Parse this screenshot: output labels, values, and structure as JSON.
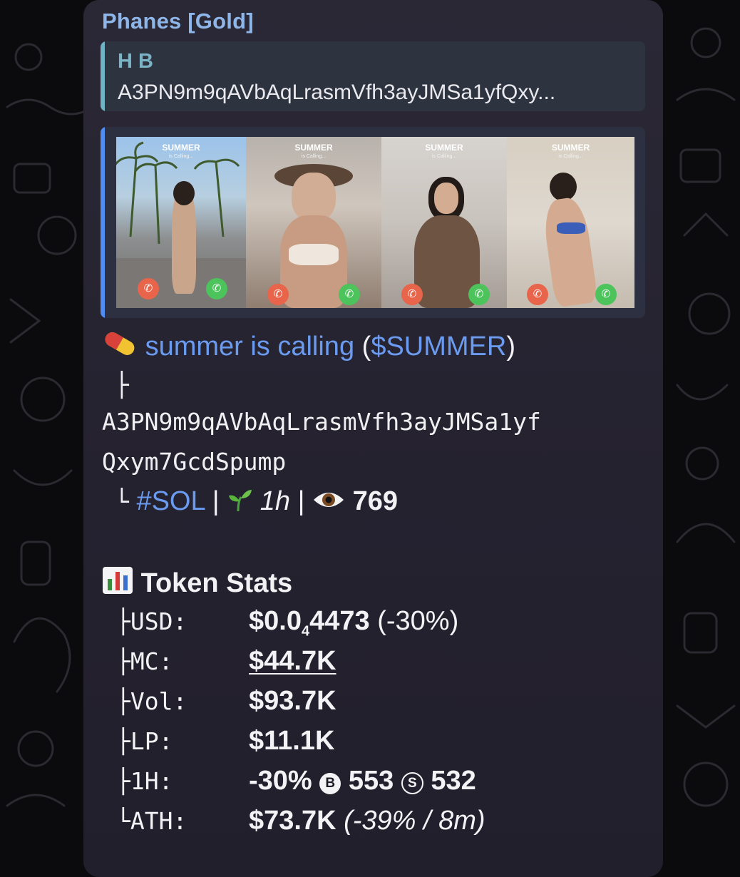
{
  "message": {
    "sender": "Phanes [Gold]",
    "reply": {
      "name": "H B",
      "text": "A3PN9m9qAVbAqLrasmVfh3ayJMSa1yfQxy..."
    },
    "preview": {
      "panels": [
        {
          "title": "SUMMER",
          "subtitle": "is Calling..."
        },
        {
          "title": "SUMMER",
          "subtitle": "is Calling..."
        },
        {
          "title": "SUMMER",
          "subtitle": "is Calling..."
        },
        {
          "title": "SUMMER",
          "subtitle": "is Calling..."
        }
      ]
    },
    "token": {
      "name": "summer is calling",
      "symbol_open": "(",
      "symbol": "$SUMMER",
      "symbol_close": ")",
      "tree_branch": "├",
      "address_line1": "A3PN9m9qAVbAqLrasmVfh3ayJMSa1yf",
      "address_line2": "Qxym7GcdSpump",
      "tree_end": "└",
      "chain_tag": "#SOL",
      "separator": "|",
      "age": "1h",
      "views": "769"
    },
    "stats": {
      "title": "Token Stats",
      "rows": {
        "usd": {
          "label": "├USD:",
          "value_prefix": "$0.0",
          "value_sub": "4",
          "value_rest": "4473",
          "change": "(-30%)"
        },
        "mc": {
          "label": "├MC:",
          "value": "$44.7K"
        },
        "vol": {
          "label": "├Vol:",
          "value": "$93.7K"
        },
        "lp": {
          "label": "├LP:",
          "value": "$11.1K"
        },
        "h1": {
          "label": "├1H:",
          "change": "-30%",
          "buy_icon": "B",
          "buys": "553",
          "sell_icon": "S",
          "sells": "532"
        },
        "ath": {
          "label": "└ATH:",
          "value": "$73.7K",
          "detail": "(-39% / 8m)"
        }
      }
    }
  },
  "icons": {
    "pill": "pill-icon",
    "seedling": "seedling-icon",
    "eye": "eye-icon",
    "chart": "bar-chart-icon"
  },
  "colors": {
    "link": "#6a9bf0",
    "sender": "#8fb6e9",
    "reply_accent": "#6fb3c4",
    "preview_accent": "#4f8ef0",
    "bubble": "#2b2836"
  }
}
